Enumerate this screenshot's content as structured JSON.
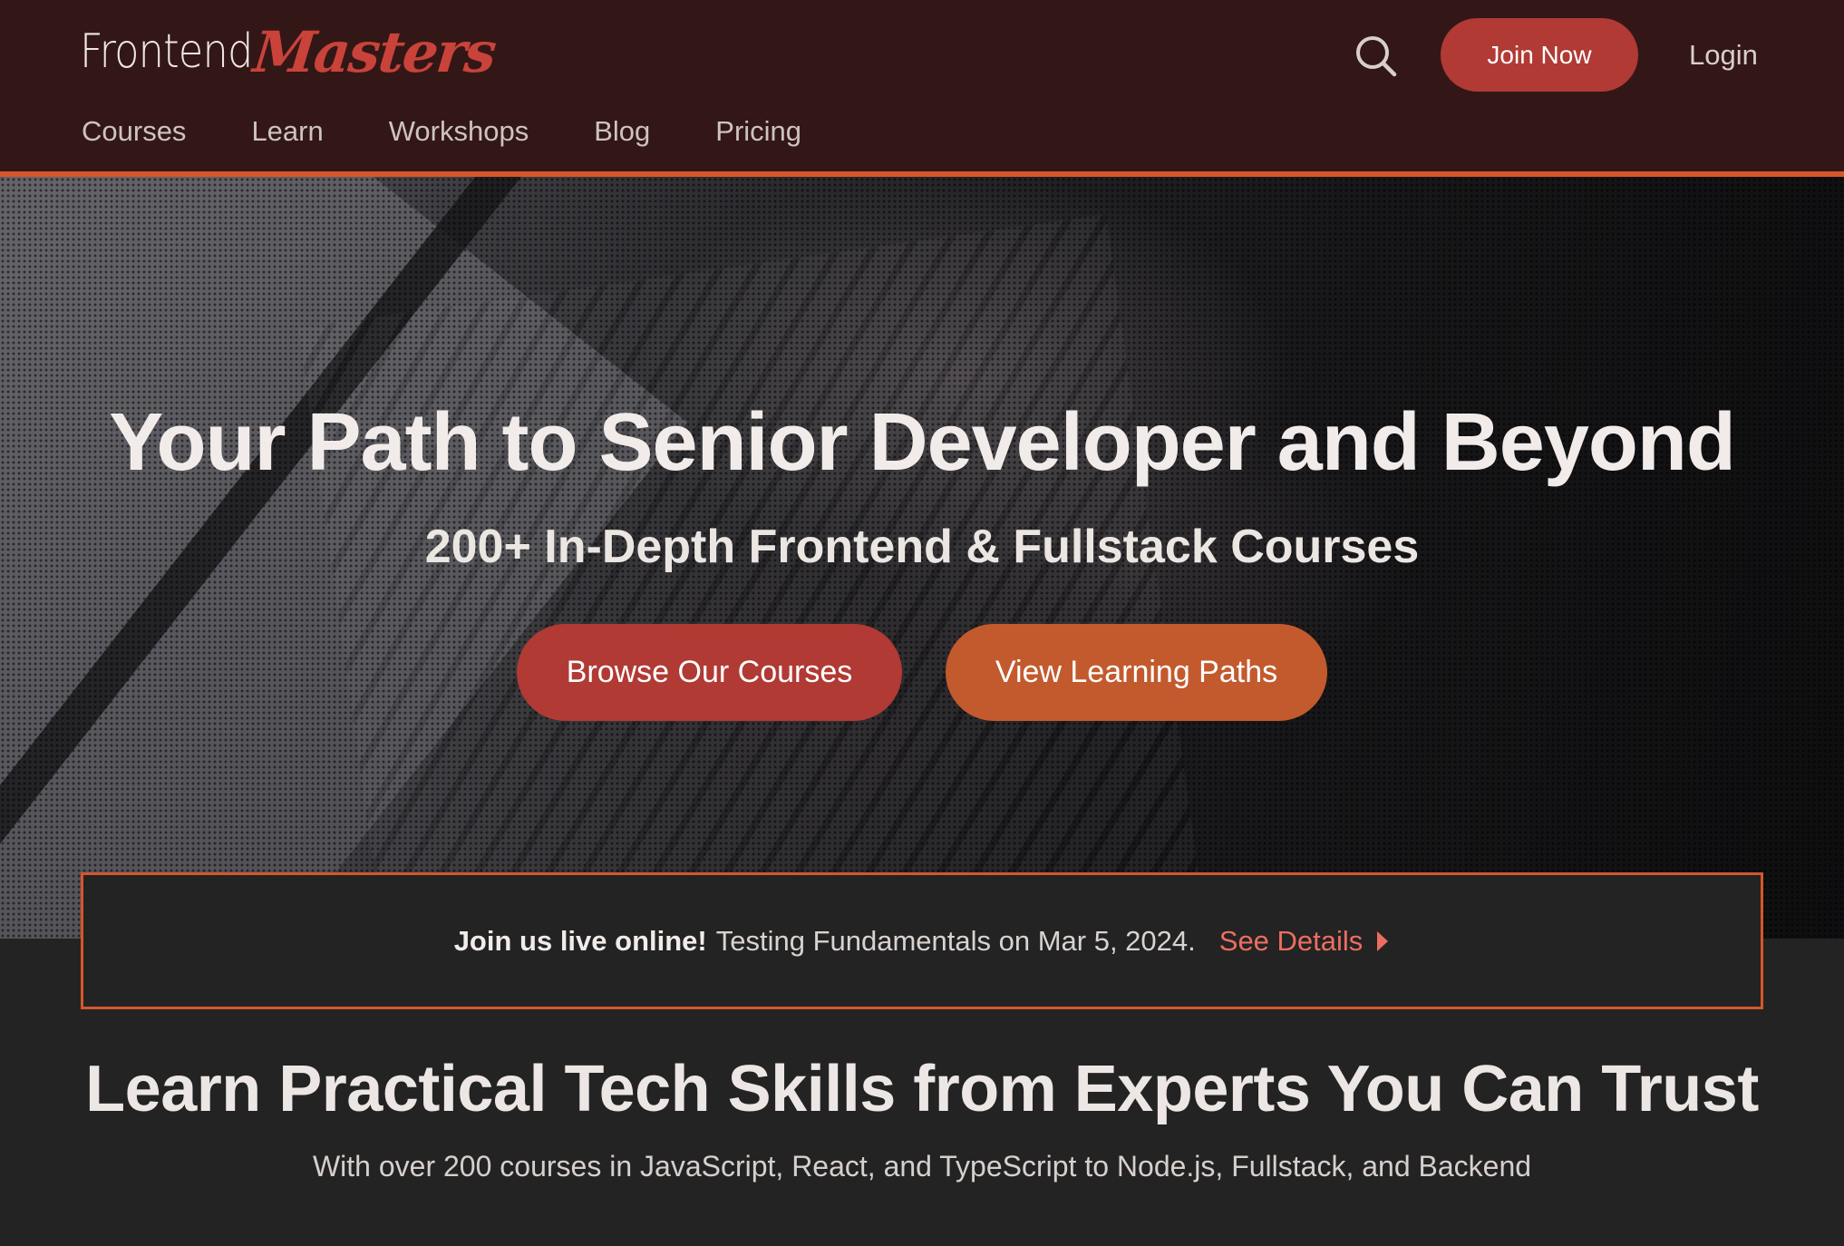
{
  "header": {
    "logo_part1": "Frontend",
    "logo_part2": "Masters",
    "join_label": "Join Now",
    "login_label": "Login",
    "nav": [
      "Courses",
      "Learn",
      "Workshops",
      "Blog",
      "Pricing"
    ]
  },
  "hero": {
    "title": "Your Path to Senior Developer and Beyond",
    "subtitle": "200+ In-Depth Frontend & Fullstack Courses",
    "browse_label": "Browse Our Courses",
    "paths_label": "View Learning Paths"
  },
  "announcement": {
    "lead": "Join us live online!",
    "text": "Testing Fundamentals on Mar 5, 2024.",
    "link": "See Details"
  },
  "section": {
    "title": "Learn Practical Tech Skills from Experts You Can Trust",
    "subtitle": "With over 200 courses in JavaScript, React, and TypeScript to Node.js, Fullstack, and Backend"
  },
  "colors": {
    "header_bg": "#331716",
    "accent_red": "#b13a34",
    "accent_orange": "#c35a2d",
    "border_orange": "#d4572b",
    "link_coral": "#ec6e61",
    "page_bg": "#232323"
  },
  "icons": {
    "search": "search-icon",
    "caret": "caret-right-icon"
  }
}
